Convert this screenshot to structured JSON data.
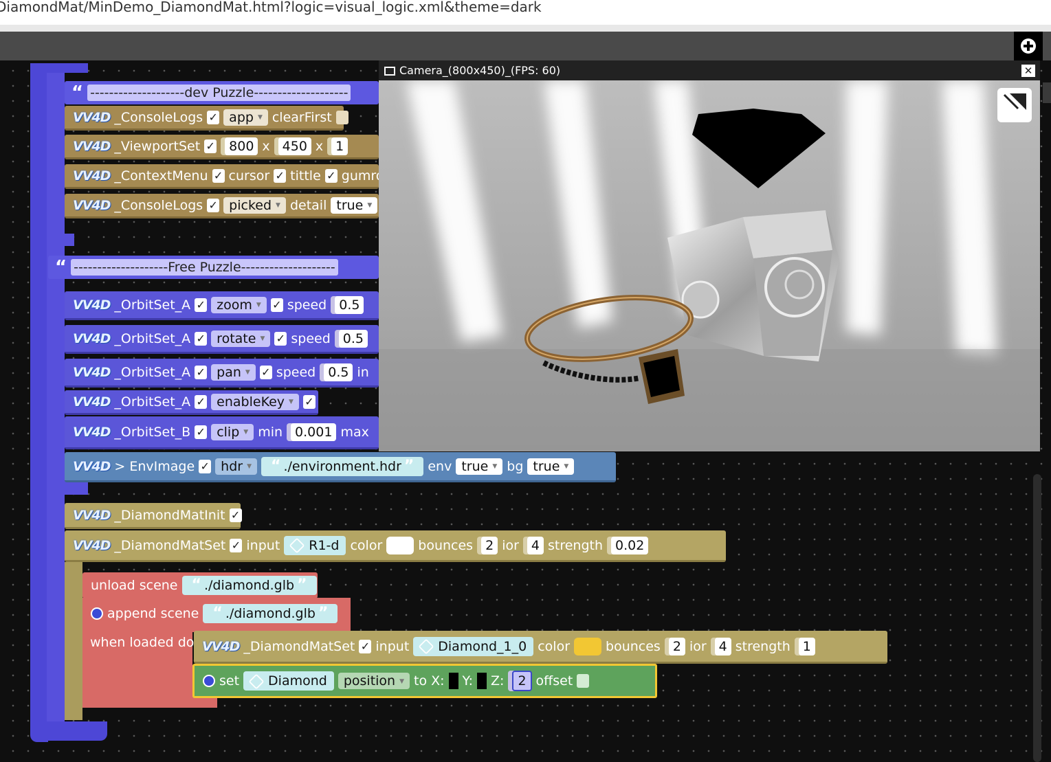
{
  "browser": {
    "url": "DiamondMat/MinDemo_DiamondMat.html?logic=visual_logic.xml&theme=dark"
  },
  "camera": {
    "title": "Camera_(800x450)_(FPS: 60)",
    "close": "✕"
  },
  "icons": {
    "add": "add-circle-icon",
    "close": "close-icon"
  },
  "brand": {
    "logo": "VV4D"
  },
  "dev": {
    "comment": "--------------------dev  Puzzle--------------------",
    "console1": {
      "label": "_ConsoleLogs",
      "opt": "app",
      "extra": "clearFirst"
    },
    "viewport": {
      "label": "_ViewportSet",
      "w": "800",
      "x1": "x",
      "h": "450",
      "x2": "x",
      "z": "1"
    },
    "context": {
      "label": "_ContextMenu",
      "a": "cursor",
      "b": "tittle",
      "c": "gumroad"
    },
    "console2": {
      "label": "_ConsoleLogs",
      "opt": "picked",
      "detail": "detail",
      "val": "true"
    }
  },
  "free": {
    "comment": "--------------------Free Puzzle--------------------",
    "orbit1": {
      "label": "_OrbitSet_A",
      "opt": "zoom",
      "speed": "speed",
      "val": "0.5"
    },
    "orbit2": {
      "label": "_OrbitSet_A",
      "opt": "rotate",
      "speed": "speed",
      "val": "0.5"
    },
    "orbit3": {
      "label": "_OrbitSet_A",
      "opt": "pan",
      "speed": "speed",
      "val": "0.5",
      "trail": "in"
    },
    "orbit4": {
      "label": "_OrbitSet_A",
      "opt": "enableKey"
    },
    "orbit5": {
      "label": "_OrbitSet_B",
      "opt": "clip",
      "min": "min",
      "minval": "0.001",
      "max": "max"
    },
    "env": {
      "label": "> EnvImage",
      "opt": "hdr",
      "file": "./environment.hdr",
      "env": "env",
      "envval": "true",
      "bg": "bg",
      "bgval": "true"
    }
  },
  "diamond": {
    "init": {
      "label": "_DiamondMatInit"
    },
    "set": {
      "label": "_DiamondMatSet",
      "input": "input",
      "obj": "R1-d",
      "color": "color",
      "bounces": "bounces",
      "bval": "2",
      "ior": "ior",
      "iorval": "4",
      "strength": "strength",
      "sval": "0.02"
    },
    "unload": {
      "label": "unload scene",
      "file": "./diamond.glb"
    },
    "append": {
      "label": "append scene",
      "file": "./diamond.glb",
      "when": "when loaded do"
    },
    "set2": {
      "label": "_DiamondMatSet",
      "input": "input",
      "obj": "Diamond_1_0",
      "color": "color",
      "bounces": "bounces",
      "bval": "2",
      "ior": "ior",
      "iorval": "4",
      "strength": "strength",
      "sval": "1"
    },
    "pos": {
      "set": "set",
      "obj": "Diamond",
      "prop": "position",
      "to": "to",
      "x": "X:",
      "y": "Y:",
      "z": "Z:",
      "zval": "2",
      "offset": "offset"
    }
  }
}
